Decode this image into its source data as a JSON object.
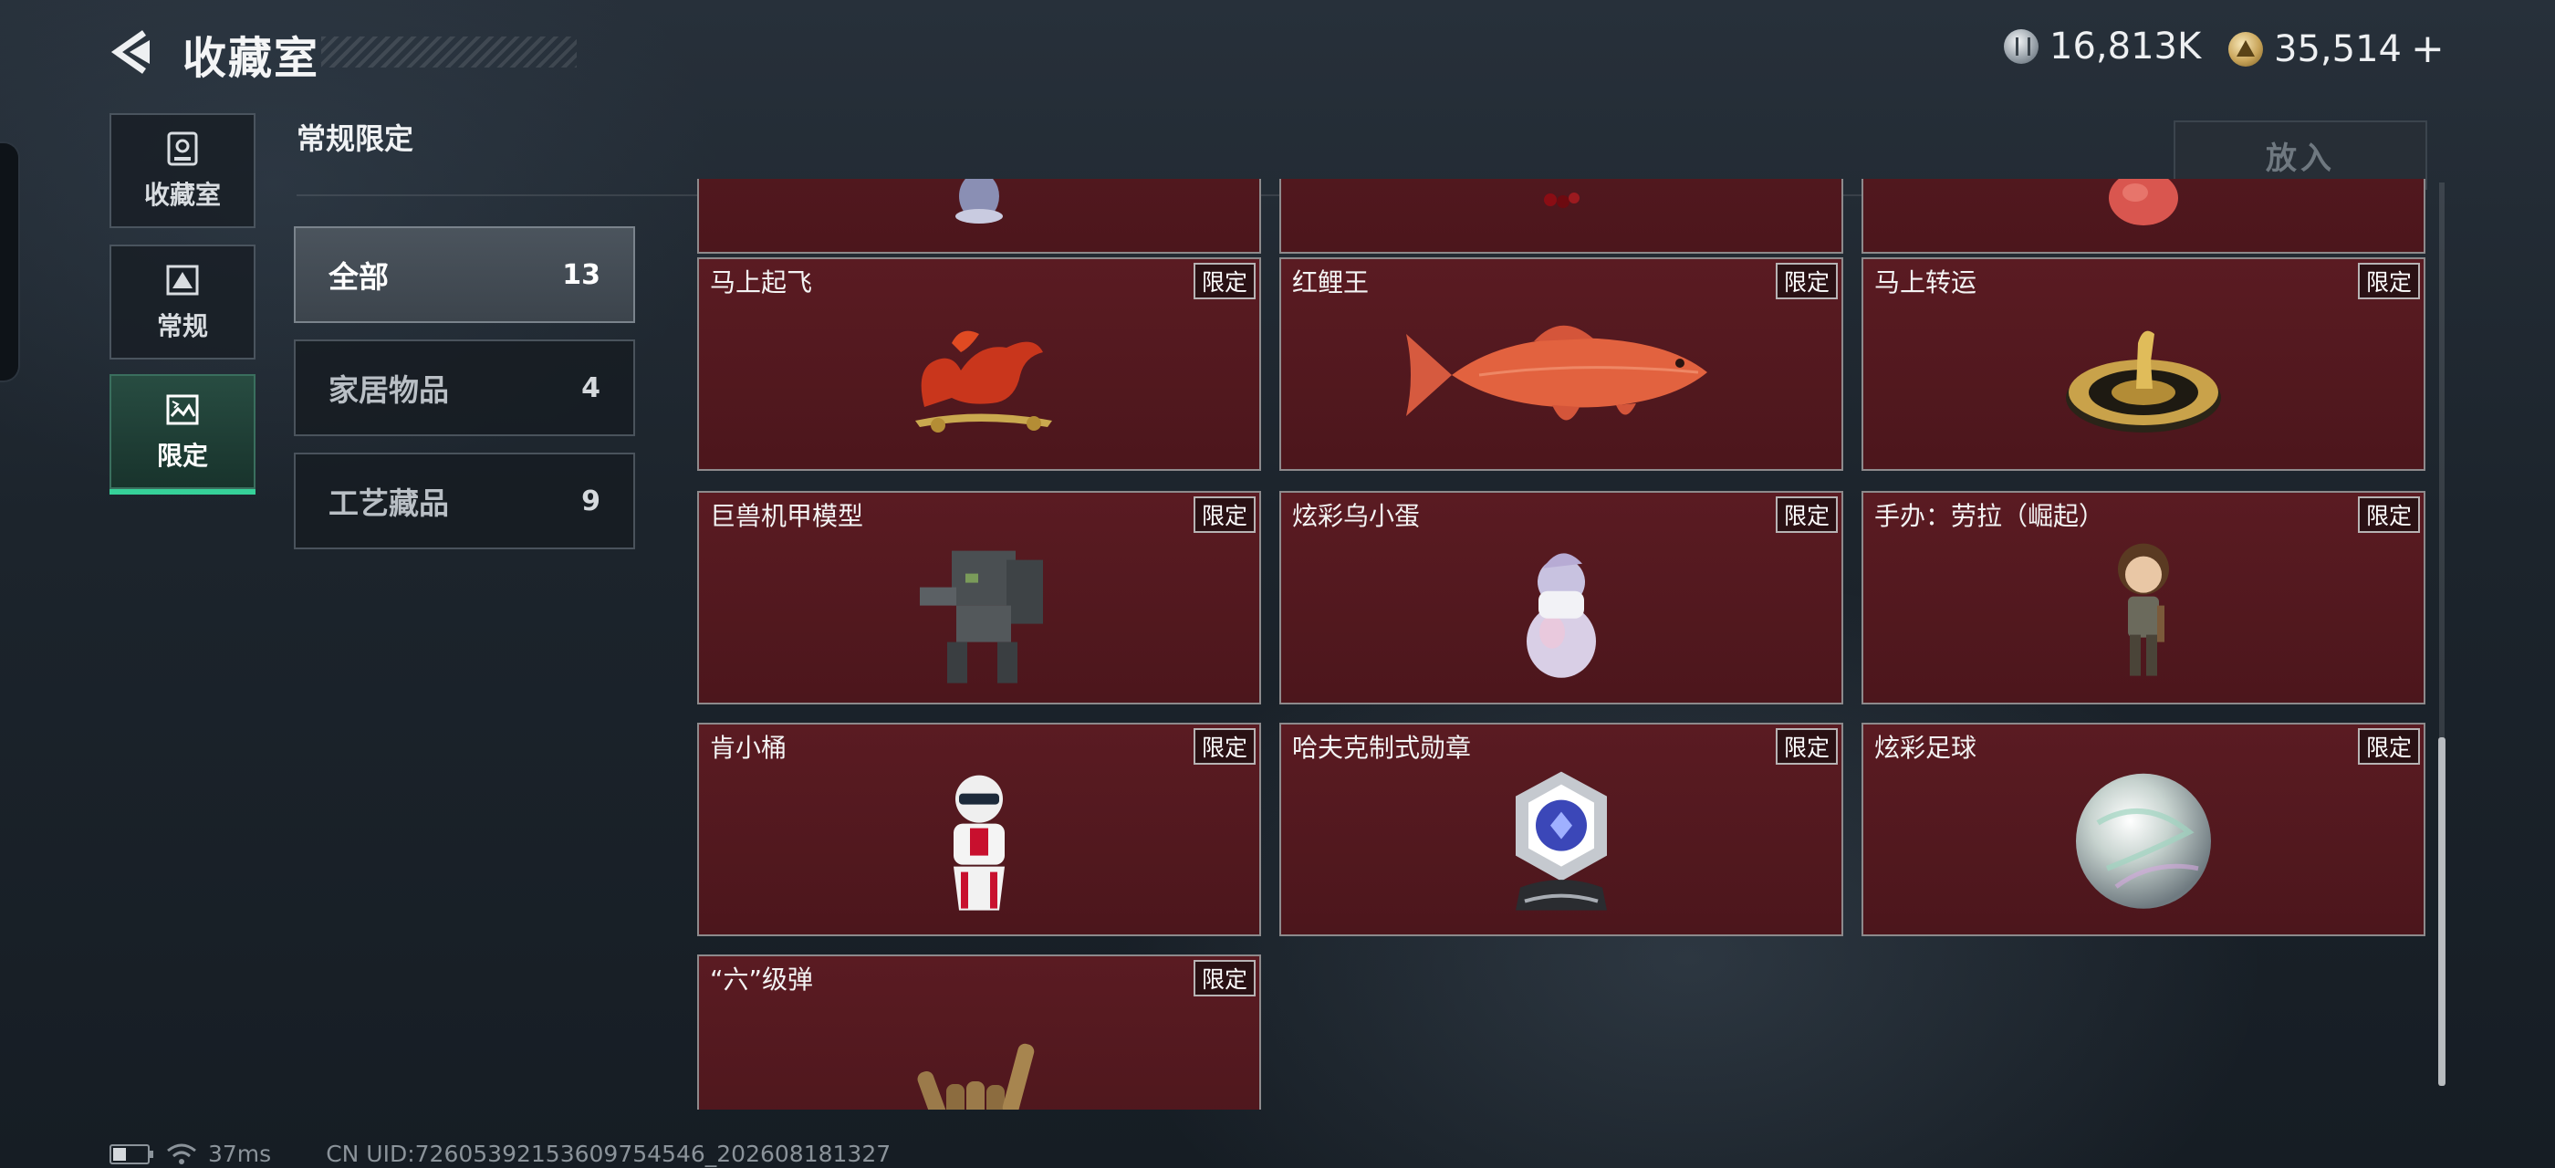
{
  "header": {
    "title": "收藏室",
    "silver_currency": "16,813K",
    "gold_currency": "35,514",
    "add_symbol": "+"
  },
  "side_nav": {
    "items": [
      {
        "label": "收藏室",
        "icon": "trophy-icon"
      },
      {
        "label": "常规",
        "icon": "picture-icon"
      },
      {
        "label": "限定",
        "icon": "limited-picture-icon"
      }
    ],
    "active_index": 2
  },
  "section": {
    "title": "常规限定",
    "place_button": "放入"
  },
  "categories": [
    {
      "label": "全部",
      "count": "13"
    },
    {
      "label": "家居物品",
      "count": "4"
    },
    {
      "label": "工艺藏品",
      "count": "9"
    }
  ],
  "grid": {
    "badge_label": "限定",
    "items": [
      {
        "name": "",
        "icon": "figurine-icon"
      },
      {
        "name": "",
        "icon": "berries-icon"
      },
      {
        "name": "",
        "icon": "peach-icon"
      },
      {
        "name": "马上起飞",
        "icon": "red-horse-icon"
      },
      {
        "name": "红鲤王",
        "icon": "red-carp-icon"
      },
      {
        "name": "马上转运",
        "icon": "golden-horse-compass-icon"
      },
      {
        "name": "巨兽机甲模型",
        "icon": "mech-model-icon"
      },
      {
        "name": "炫彩乌小蛋",
        "icon": "egg-figure-icon"
      },
      {
        "name": "手办：劳拉（崛起）",
        "icon": "lara-figure-icon"
      },
      {
        "name": "肯小桶",
        "icon": "kfc-figure-icon"
      },
      {
        "name": "哈夫克制式勋章",
        "icon": "medal-icon"
      },
      {
        "name": "炫彩足球",
        "icon": "iridescent-ball-icon"
      },
      {
        "name": "“六”级弹",
        "icon": "hand-sign-icon"
      }
    ]
  },
  "footer": {
    "ping": "37ms",
    "uid": "CN UID:72605392153609754546_202608181327"
  },
  "colors": {
    "accent_green": "#36d199",
    "card_bg": "#4c161c",
    "card_border": "#8d8a8c"
  }
}
